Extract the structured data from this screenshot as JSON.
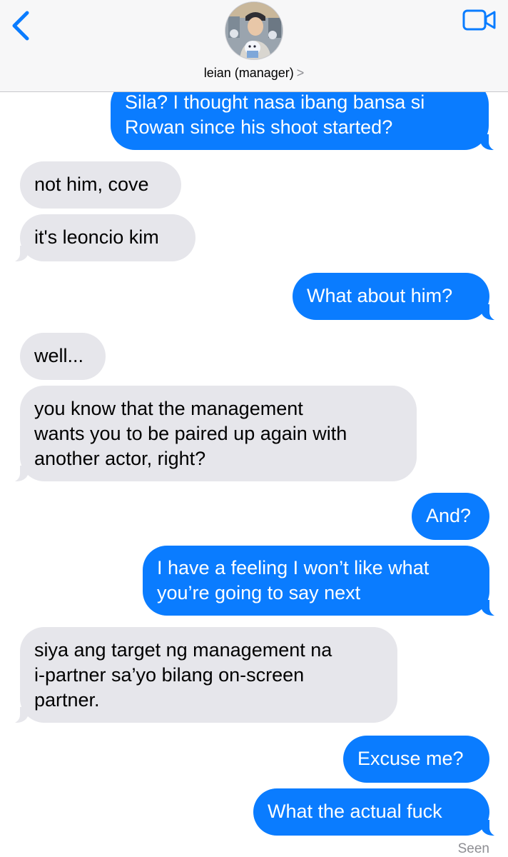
{
  "header": {
    "contact_name": "leian (manager)",
    "chevron": ">",
    "back_icon": "chevron-left-icon",
    "video_icon": "video-camera-icon",
    "accent_color": "#0a7cff"
  },
  "messages": [
    {
      "sender": "me",
      "text": "Sila? I thought nasa ibang bansa si\nRowan since his shoot started?"
    },
    {
      "sender": "them",
      "text": "not him, cove"
    },
    {
      "sender": "them",
      "text": "it's leoncio kim"
    },
    {
      "sender": "me",
      "text": "What about him?"
    },
    {
      "sender": "them",
      "text": "well..."
    },
    {
      "sender": "them",
      "text": "you know that the management\nwants you to be paired up again with\nanother actor, right?"
    },
    {
      "sender": "me",
      "text": "And?"
    },
    {
      "sender": "me",
      "text": "I have a feeling I won’t like what\nyou’re going to say next"
    },
    {
      "sender": "them",
      "text": "siya ang target ng management na\ni-partner sa’yo bilang on-screen\npartner."
    },
    {
      "sender": "me",
      "text": "Excuse me?"
    },
    {
      "sender": "me",
      "text": "What the actual fuck"
    }
  ],
  "status": {
    "read_receipt": "Seen"
  },
  "colors": {
    "outgoing_bubble": "#0a7cff",
    "incoming_bubble": "#e6e6eb",
    "header_bg": "#f7f7f8"
  }
}
